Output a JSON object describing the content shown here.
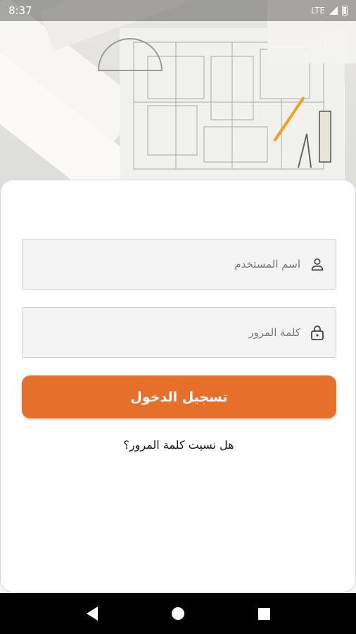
{
  "status_bar": {
    "time": "8:37",
    "network": "LTE",
    "icons": [
      "signal-icon",
      "battery-icon"
    ]
  },
  "hero": {
    "image": "architectural-blueprint-background"
  },
  "login": {
    "username_placeholder": "اسم المستخدم",
    "username_icon": "user-icon",
    "password_placeholder": "كلمة المرور",
    "password_icon": "lock-icon",
    "submit_label": "تسجيل الدخول",
    "forgot_password_label": "هل نسيت كلمة المرور؟"
  },
  "colors": {
    "accent": "#e66f2b",
    "field_bg": "#f4f4f4",
    "card_bg": "#ffffff"
  },
  "nav_bar": {
    "buttons": [
      "back-icon",
      "home-icon",
      "recents-icon"
    ]
  }
}
